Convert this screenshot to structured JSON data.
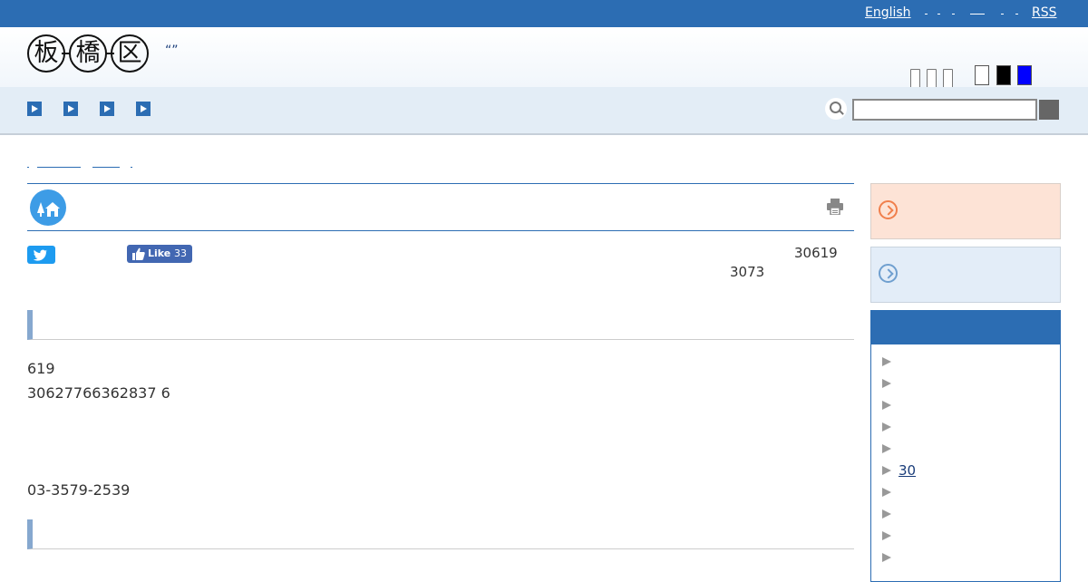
{
  "topbar": {
    "english": "English",
    "rss": "RSS"
  },
  "header": {
    "logo_chars": [
      "板",
      "橋",
      "区"
    ],
    "tagline": "“”"
  },
  "share": {
    "fb_like": "Like",
    "fb_count": "33"
  },
  "article": {
    "date_published": "30619",
    "date_updated": "3073",
    "para1": "619",
    "para2": "30627766362837 6",
    "phone": "03-3579-2539"
  },
  "sidebar": {
    "menu_items": [
      "",
      "",
      "",
      "",
      "",
      "30",
      "",
      "",
      "",
      ""
    ]
  },
  "colors": {
    "brand_blue": "#2c6db3",
    "accent_orange_bg": "#fde3d6",
    "accent_blue_bg": "#e3edf8"
  }
}
